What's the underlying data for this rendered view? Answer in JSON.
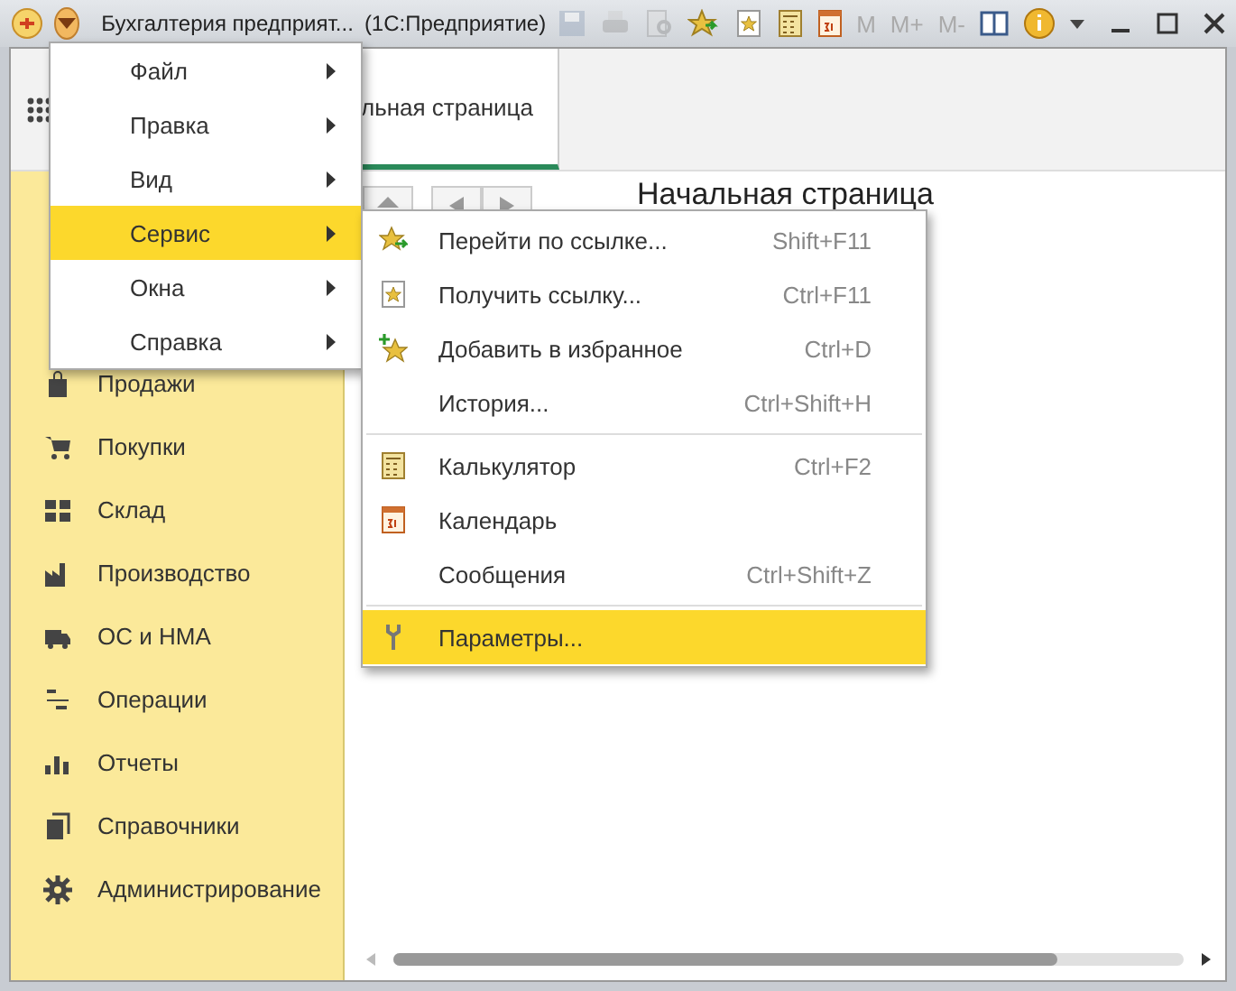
{
  "window": {
    "title": "Бухгалтерия предприят...",
    "app_name": "(1С:Предприятие)"
  },
  "toolbar": [
    {
      "kind": "save",
      "disabled": true
    },
    {
      "kind": "print",
      "disabled": true
    },
    {
      "kind": "preview",
      "disabled": true
    },
    {
      "kind": "favorites",
      "disabled": false
    },
    {
      "kind": "link",
      "disabled": false
    },
    {
      "kind": "calculator",
      "disabled": false
    },
    {
      "kind": "calendar",
      "disabled": false
    },
    {
      "kind": "memory",
      "label": "M",
      "disabled": true
    },
    {
      "kind": "memory",
      "label": "M+",
      "disabled": true
    },
    {
      "kind": "memory",
      "label": "M-",
      "disabled": true
    },
    {
      "kind": "panel",
      "disabled": false
    },
    {
      "kind": "info",
      "disabled": false
    }
  ],
  "tab": {
    "label": "льная страница",
    "selected": true
  },
  "heading": "Начальная страница",
  "sidebar": [
    {
      "label": "Продажи",
      "kind": "bag"
    },
    {
      "label": "Покупки",
      "kind": "cart"
    },
    {
      "label": "Склад",
      "kind": "grid"
    },
    {
      "label": "Производство",
      "kind": "factory"
    },
    {
      "label": "ОС и НМА",
      "kind": "truck"
    },
    {
      "label": "Операции",
      "kind": "dtkt"
    },
    {
      "label": "Отчеты",
      "kind": "bars"
    },
    {
      "label": "Справочники",
      "kind": "books"
    },
    {
      "label": "Администрирование",
      "kind": "gear"
    }
  ],
  "main_menu": [
    {
      "label": "Файл",
      "selected": false
    },
    {
      "label": "Правка",
      "selected": false
    },
    {
      "label": "Вид",
      "selected": false
    },
    {
      "label": "Сервис",
      "selected": true
    },
    {
      "label": "Окна",
      "selected": false
    },
    {
      "label": "Справка",
      "selected": false
    }
  ],
  "submenu": [
    {
      "kind": "goto",
      "label": "Перейти по ссылке...",
      "shortcut": "Shift+F11",
      "selected": false
    },
    {
      "kind": "link",
      "label": "Получить ссылку...",
      "shortcut": "Ctrl+F11",
      "selected": false
    },
    {
      "kind": "addfav",
      "label": "Добавить в избранное",
      "shortcut": "Ctrl+D",
      "selected": false
    },
    {
      "kind": "plain",
      "label": "История...",
      "shortcut": "Ctrl+Shift+H",
      "selected": false
    },
    {
      "kind": "separator"
    },
    {
      "kind": "calculator",
      "label": "Калькулятор",
      "shortcut": "Ctrl+F2",
      "selected": false
    },
    {
      "kind": "calendar",
      "label": "Календарь",
      "selected": false
    },
    {
      "kind": "plain",
      "label": "Сообщения",
      "shortcut": "Ctrl+Shift+Z",
      "selected": false
    },
    {
      "kind": "separator"
    },
    {
      "kind": "wrench",
      "label": "Параметры...",
      "selected": true
    }
  ]
}
